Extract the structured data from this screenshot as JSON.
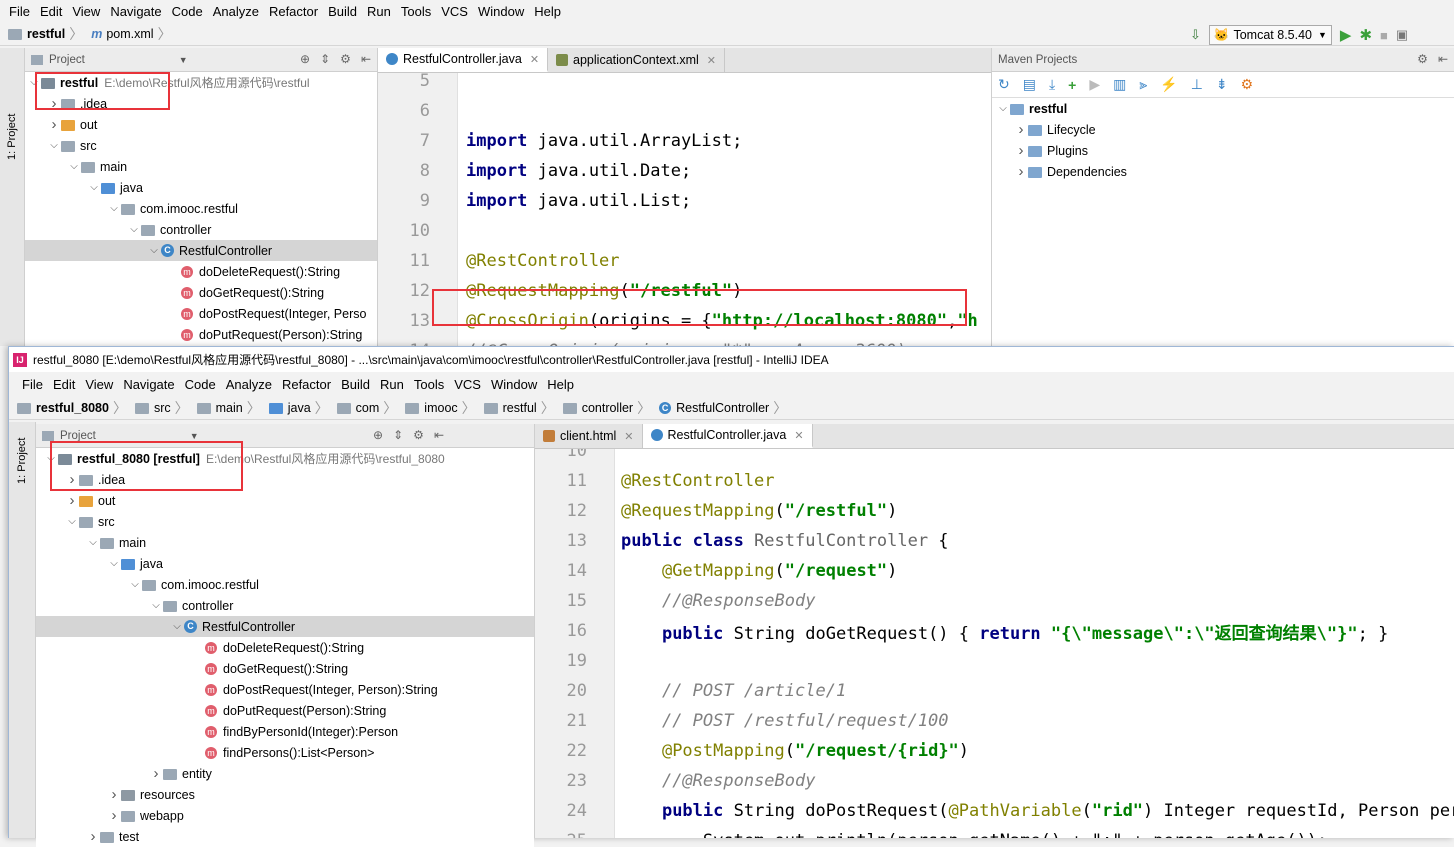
{
  "menu": [
    "File",
    "Edit",
    "View",
    "Navigate",
    "Code",
    "Analyze",
    "Refactor",
    "Build",
    "Run",
    "Tools",
    "VCS",
    "Window",
    "Help"
  ],
  "top": {
    "crumbs": [
      "restful",
      "pom.xml"
    ],
    "run_config": "Tomcat 8.5.40",
    "project_header": "Project",
    "stripe_label": "1: Project",
    "tree": [
      {
        "label": "restful",
        "path": "E:\\demo\\Restful风格应用源代码\\restful",
        "depth": 0,
        "open": "v",
        "icon": "module"
      },
      {
        "label": ".idea",
        "depth": 1,
        "open": ">",
        "icon": "folder"
      },
      {
        "label": "out",
        "depth": 1,
        "open": ">",
        "icon": "orange"
      },
      {
        "label": "src",
        "depth": 1,
        "open": "v",
        "icon": "folder"
      },
      {
        "label": "main",
        "depth": 2,
        "open": "v",
        "icon": "folder"
      },
      {
        "label": "java",
        "depth": 3,
        "open": "v",
        "icon": "blue"
      },
      {
        "label": "com.imooc.restful",
        "depth": 4,
        "open": "v",
        "icon": "folder"
      },
      {
        "label": "controller",
        "depth": 5,
        "open": "v",
        "icon": "folder"
      },
      {
        "label": "RestfulController",
        "depth": 6,
        "open": "v",
        "icon": "class",
        "selected": true
      },
      {
        "label": "doDeleteRequest():String",
        "depth": 7,
        "icon": "method"
      },
      {
        "label": "doGetRequest():String",
        "depth": 7,
        "icon": "method"
      },
      {
        "label": "doPostRequest(Integer, Perso",
        "depth": 7,
        "icon": "method"
      },
      {
        "label": "doPutRequest(Person):String",
        "depth": 7,
        "icon": "method"
      }
    ],
    "tabs": [
      {
        "label": "RestfulController.java",
        "active": true
      },
      {
        "label": "applicationContext.xml",
        "active": false
      }
    ],
    "maven_title": "Maven Projects",
    "maven_tree": [
      {
        "label": "restful",
        "depth": 0,
        "open": "v"
      },
      {
        "label": "Lifecycle",
        "depth": 1,
        "open": ">"
      },
      {
        "label": "Plugins",
        "depth": 1,
        "open": ">"
      },
      {
        "label": "Dependencies",
        "depth": 1,
        "open": ">"
      }
    ]
  },
  "bottom": {
    "window_title": "restful_8080 [E:\\demo\\Restful风格应用源代码\\restful_8080] - ...\\src\\main\\java\\com\\imooc\\restful\\controller\\RestfulController.java [restful] - IntelliJ IDEA",
    "crumbs": [
      "restful_8080",
      "src",
      "main",
      "java",
      "com",
      "imooc",
      "restful",
      "controller",
      "RestfulController"
    ],
    "project_header": "Project",
    "stripe_label": "1: Project",
    "tree": [
      {
        "label": "restful_8080 [restful]",
        "path": "E:\\demo\\Restful风格应用源代码\\restful_8080",
        "depth": 0,
        "open": "v",
        "icon": "module"
      },
      {
        "label": ".idea",
        "depth": 1,
        "open": ">",
        "icon": "folder"
      },
      {
        "label": "out",
        "depth": 1,
        "open": ">",
        "icon": "orange"
      },
      {
        "label": "src",
        "depth": 1,
        "open": "v",
        "icon": "folder"
      },
      {
        "label": "main",
        "depth": 2,
        "open": "v",
        "icon": "folder"
      },
      {
        "label": "java",
        "depth": 3,
        "open": "v",
        "icon": "blue"
      },
      {
        "label": "com.imooc.restful",
        "depth": 4,
        "open": "v",
        "icon": "folder"
      },
      {
        "label": "controller",
        "depth": 5,
        "open": "v",
        "icon": "folder"
      },
      {
        "label": "RestfulController",
        "depth": 6,
        "open": "v",
        "icon": "class",
        "selected": true
      },
      {
        "label": "doDeleteRequest():String",
        "depth": 7,
        "icon": "method"
      },
      {
        "label": "doGetRequest():String",
        "depth": 7,
        "icon": "method"
      },
      {
        "label": "doPostRequest(Integer, Person):String",
        "depth": 7,
        "icon": "method"
      },
      {
        "label": "doPutRequest(Person):String",
        "depth": 7,
        "icon": "method"
      },
      {
        "label": "findByPersonId(Integer):Person",
        "depth": 7,
        "icon": "method"
      },
      {
        "label": "findPersons():List<Person>",
        "depth": 7,
        "icon": "method"
      },
      {
        "label": "entity",
        "depth": 5,
        "open": ">",
        "icon": "folder"
      },
      {
        "label": "resources",
        "depth": 3,
        "open": ">",
        "icon": "gray"
      },
      {
        "label": "webapp",
        "depth": 3,
        "open": ">",
        "icon": "folder"
      },
      {
        "label": "test",
        "depth": 2,
        "open": ">",
        "icon": "folder"
      }
    ],
    "tabs": [
      {
        "label": "client.html",
        "active": false
      },
      {
        "label": "RestfulController.java",
        "active": true
      }
    ]
  },
  "colors": {
    "red_box": "#e8333a",
    "annotation": "#808000",
    "string": "#008000",
    "keyword": "#000080",
    "selection": "#d5d5d5"
  }
}
